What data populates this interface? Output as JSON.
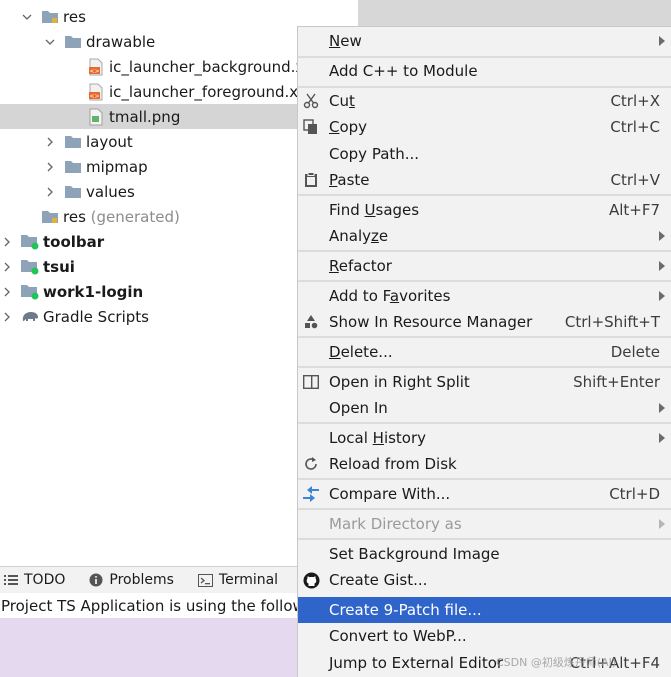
{
  "tree": {
    "items": [
      {
        "label": "res",
        "bold": false
      },
      {
        "label": "drawable",
        "bold": false
      },
      {
        "label": "ic_launcher_background.x",
        "bold": false
      },
      {
        "label": "ic_launcher_foreground.x",
        "bold": false
      },
      {
        "label": "tmall.png",
        "bold": false
      },
      {
        "label": "layout",
        "bold": false
      },
      {
        "label": "mipmap",
        "bold": false
      },
      {
        "label": "values",
        "bold": false
      },
      {
        "label": "res",
        "suffix": "(generated)",
        "bold": false
      },
      {
        "label": "toolbar",
        "bold": true
      },
      {
        "label": "tsui",
        "bold": true
      },
      {
        "label": "work1-login",
        "bold": true
      },
      {
        "label": "Gradle Scripts",
        "bold": false
      }
    ]
  },
  "tool_windows": {
    "tabs": [
      {
        "label": "TODO",
        "icon": "list-icon"
      },
      {
        "label": "Problems",
        "icon": "info-circle-icon"
      },
      {
        "label": "Terminal",
        "icon": "terminal-icon"
      }
    ]
  },
  "status": {
    "text": "Project TS Application is using the followi"
  },
  "context_menu": {
    "items": [
      {
        "label": "New",
        "underline": "N",
        "shortcut": "",
        "submenu": true,
        "icon": ""
      },
      {
        "label": "Add C++ to Module",
        "underline": "",
        "shortcut": "",
        "submenu": false,
        "icon": ""
      },
      {
        "label": "Cut",
        "underline": "t",
        "shortcut": "Ctrl+X",
        "submenu": false,
        "icon": "scissors-icon"
      },
      {
        "label": "Copy",
        "underline": "C",
        "shortcut": "Ctrl+C",
        "submenu": false,
        "icon": "copy-icon"
      },
      {
        "label": "Copy Path...",
        "underline": "",
        "shortcut": "",
        "submenu": false,
        "icon": ""
      },
      {
        "label": "Paste",
        "underline": "P",
        "shortcut": "Ctrl+V",
        "submenu": false,
        "icon": "clipboard-icon"
      },
      {
        "label": "Find Usages",
        "underline": "U",
        "shortcut": "Alt+F7",
        "submenu": false,
        "icon": ""
      },
      {
        "label": "Analyze",
        "underline": "z",
        "shortcut": "",
        "submenu": true,
        "icon": ""
      },
      {
        "label": "Refactor",
        "underline": "R",
        "shortcut": "",
        "submenu": true,
        "icon": ""
      },
      {
        "label": "Add to Favorites",
        "underline": "a",
        "shortcut": "",
        "submenu": true,
        "icon": ""
      },
      {
        "label": "Show In Resource Manager",
        "underline": "",
        "shortcut": "Ctrl+Shift+T",
        "submenu": false,
        "icon": "resource-manager-icon"
      },
      {
        "label": "Delete...",
        "underline": "D",
        "shortcut": "Delete",
        "submenu": false,
        "icon": ""
      },
      {
        "label": "Open in Right Split",
        "underline": "",
        "shortcut": "Shift+Enter",
        "submenu": false,
        "icon": "split-view-icon"
      },
      {
        "label": "Open In",
        "underline": "",
        "shortcut": "",
        "submenu": true,
        "icon": ""
      },
      {
        "label": "Local History",
        "underline": "H",
        "shortcut": "",
        "submenu": true,
        "icon": ""
      },
      {
        "label": "Reload from Disk",
        "underline": "",
        "shortcut": "",
        "submenu": false,
        "icon": "reload-icon"
      },
      {
        "label": "Compare With...",
        "underline": "",
        "shortcut": "Ctrl+D",
        "submenu": false,
        "icon": "compare-icon"
      },
      {
        "label": "Mark Directory as",
        "underline": "",
        "shortcut": "",
        "submenu": true,
        "disabled": true,
        "icon": ""
      },
      {
        "label": "Set Background Image",
        "underline": "",
        "shortcut": "",
        "submenu": false,
        "icon": ""
      },
      {
        "label": "Create Gist...",
        "underline": "",
        "shortcut": "",
        "submenu": false,
        "icon": "github-icon"
      },
      {
        "label": "Create 9-Patch file...",
        "underline": "",
        "shortcut": "",
        "submenu": false,
        "highlight": true,
        "icon": ""
      },
      {
        "label": "Convert to WebP...",
        "underline": "",
        "shortcut": "",
        "submenu": false,
        "icon": ""
      },
      {
        "label": "Jump to External Editor",
        "underline": "",
        "shortcut": "Ctrl+Alt+F4",
        "submenu": false,
        "icon": ""
      }
    ]
  },
  "watermark": "CSDN @初级炼丹师(AI)",
  "colors": {
    "menu_bg": "#f2f2f2",
    "highlight": "#2f65ca",
    "selection": "#d5d5d5",
    "folder": "#8fa3b8",
    "module_dot": "#21c35b",
    "status_bg": "#e5d9ef"
  }
}
